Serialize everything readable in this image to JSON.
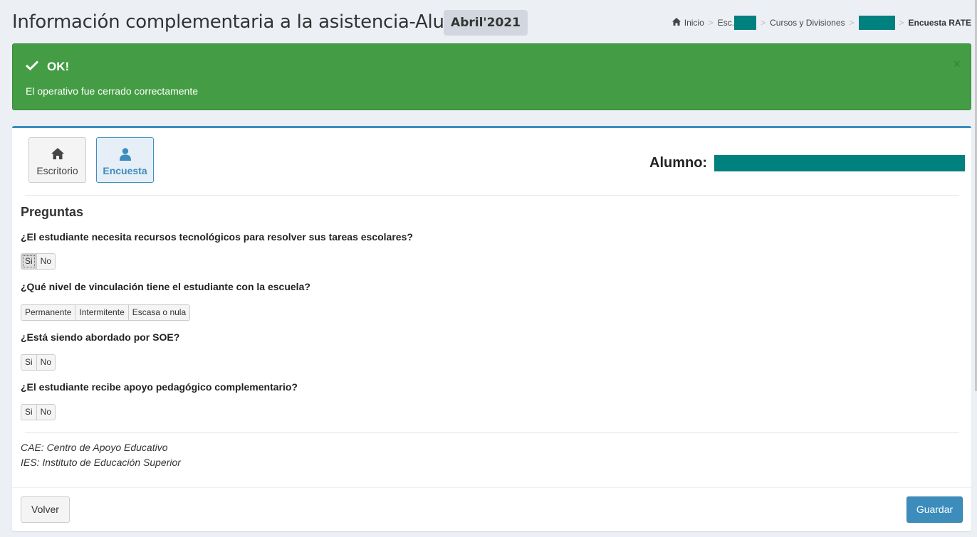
{
  "header": {
    "title": "Información complementaria a la asistencia-Alumno",
    "period": "Abril'2021"
  },
  "breadcrumb": {
    "home": "Inicio",
    "school": "Esc.",
    "courses": "Cursos y Divisiones",
    "current": "Encuesta RATE",
    "separator": ">",
    "redaction_color": "#00807f"
  },
  "alert": {
    "title": "OK!",
    "message": "El operativo fue cerrado correctamente",
    "close": "×",
    "color": "#449d44"
  },
  "nav": {
    "escritorio": "Escritorio",
    "encuesta": "Encuesta"
  },
  "student": {
    "label": "Alumno:"
  },
  "questions": {
    "section_title": "Preguntas",
    "q1": {
      "text": "¿El estudiante necesita recursos tecnológicos para resolver sus tareas escolares?",
      "options": [
        "Si",
        "No"
      ],
      "focused": "Si"
    },
    "q2": {
      "text": "¿Qué nivel de vinculación tiene el estudiante con la escuela?",
      "options": [
        "Permanente",
        "Intermitente",
        "Escasa o nula"
      ]
    },
    "q3": {
      "text": "¿Está siendo abordado por SOE?",
      "options": [
        "Si",
        "No"
      ]
    },
    "q4": {
      "text": "¿El estudiante recibe apoyo pedagógico complementario?",
      "options": [
        "Si",
        "No"
      ]
    }
  },
  "notes": {
    "cae": "CAE: Centro de Apoyo Educativo",
    "ies": "IES: Instituto de Educación Superior"
  },
  "footer": {
    "back": "Volver",
    "save": "Guardar"
  },
  "colors": {
    "primary": "#3c8dbc",
    "success": "#449d44",
    "redacted": "#00807f"
  }
}
